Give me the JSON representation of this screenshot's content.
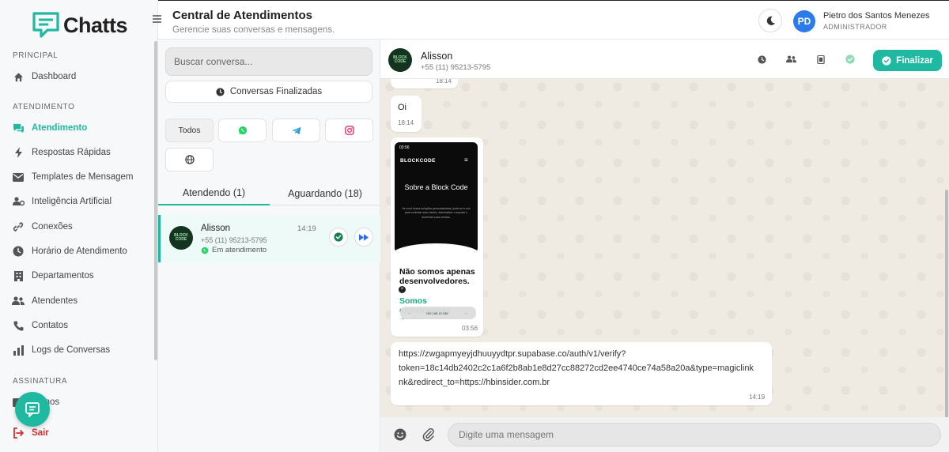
{
  "app": {
    "name": "Chatts",
    "colors": {
      "accent": "#1fb8a0",
      "danger": "#d32f2f",
      "avatar": "#2b7bea"
    }
  },
  "sidebar": {
    "sections": [
      {
        "title": "PRINCIPAL",
        "items": [
          {
            "label": "Dashboard",
            "icon": "home-icon"
          }
        ]
      },
      {
        "title": "ATENDIMENTO",
        "items": [
          {
            "label": "Atendimento",
            "icon": "chat-icon",
            "active": true
          },
          {
            "label": "Respostas Rápidas",
            "icon": "bolt-icon"
          },
          {
            "label": "Templates de Mensagem",
            "icon": "envelope-icon"
          },
          {
            "label": "Inteligência Artificial",
            "icon": "users-cog-icon"
          },
          {
            "label": "Conexões",
            "icon": "link-icon"
          },
          {
            "label": "Horário de Atendimento",
            "icon": "clock-icon"
          },
          {
            "label": "Departamentos",
            "icon": "building-icon"
          },
          {
            "label": "Atendentes",
            "icon": "users-icon"
          },
          {
            "label": "Contatos",
            "icon": "phone-icon"
          },
          {
            "label": "Logs de Conversas",
            "icon": "chart-icon"
          }
        ]
      },
      {
        "title": "ASSINATURA",
        "items": [
          {
            "label": "Planos",
            "icon": "card-icon"
          }
        ]
      }
    ],
    "logout_label": "Sair"
  },
  "header": {
    "title": "Central de Atendimentos",
    "subtitle": "Gerencie suas conversas e mensagens.",
    "user": {
      "initials": "PD",
      "name": "Pietro dos Santos Menezes",
      "role": "ADMINISTRADOR"
    }
  },
  "conversations": {
    "search_placeholder": "Buscar conversa...",
    "finished_label": "Conversas Finalizadas",
    "filters": {
      "all_label": "Todos"
    },
    "tabs": [
      {
        "label": "Atendendo (1)",
        "active": true
      },
      {
        "label": "Aguardando (18)",
        "active": false
      }
    ],
    "items": [
      {
        "name": "Alisson",
        "time": "14:19",
        "phone": "+55 (11) 95213-5795",
        "status": "Em atendimento",
        "avatar_text": "BLOCK CODE"
      }
    ]
  },
  "chat": {
    "contact": {
      "name": "Alisson",
      "phone": "+55 (11) 95213-5795",
      "avatar_text": "BLOCK CODE"
    },
    "finalize_label": "Finalizar",
    "messages": [
      {
        "time": "18:14"
      },
      {
        "text": "Oi",
        "time": "18:14"
      },
      {
        "type": "image",
        "time": "03:56",
        "screenshot": {
          "status_time": "03:56",
          "brand": "BLOCKCODE",
          "heading": "Sobre a Block Code",
          "body": "Se você busca soluções personalizadas, junte-se a nós para controlar seus dados, automatizar o suporte e aumentar suas vendas.",
          "headline": "Não somos apenas desenvolvedores.",
          "headline_accent": "Somos estrategistas digitais",
          "url": "192.168.15.186"
        }
      },
      {
        "type": "text",
        "lines": [
          "https://zwgapmyeyjdhuuyydtpr.supabase.co/auth/v1/verify?",
          "token=18c14db2402c2c1a6f2b8ab1e8d27cc88272cd2ee4740ce74a58a20a&type=magiclink",
          "nk&redirect_to=https://hbinsider.com.br"
        ],
        "time": "14:19"
      }
    ],
    "composer_placeholder": "Digite uma mensagem"
  }
}
